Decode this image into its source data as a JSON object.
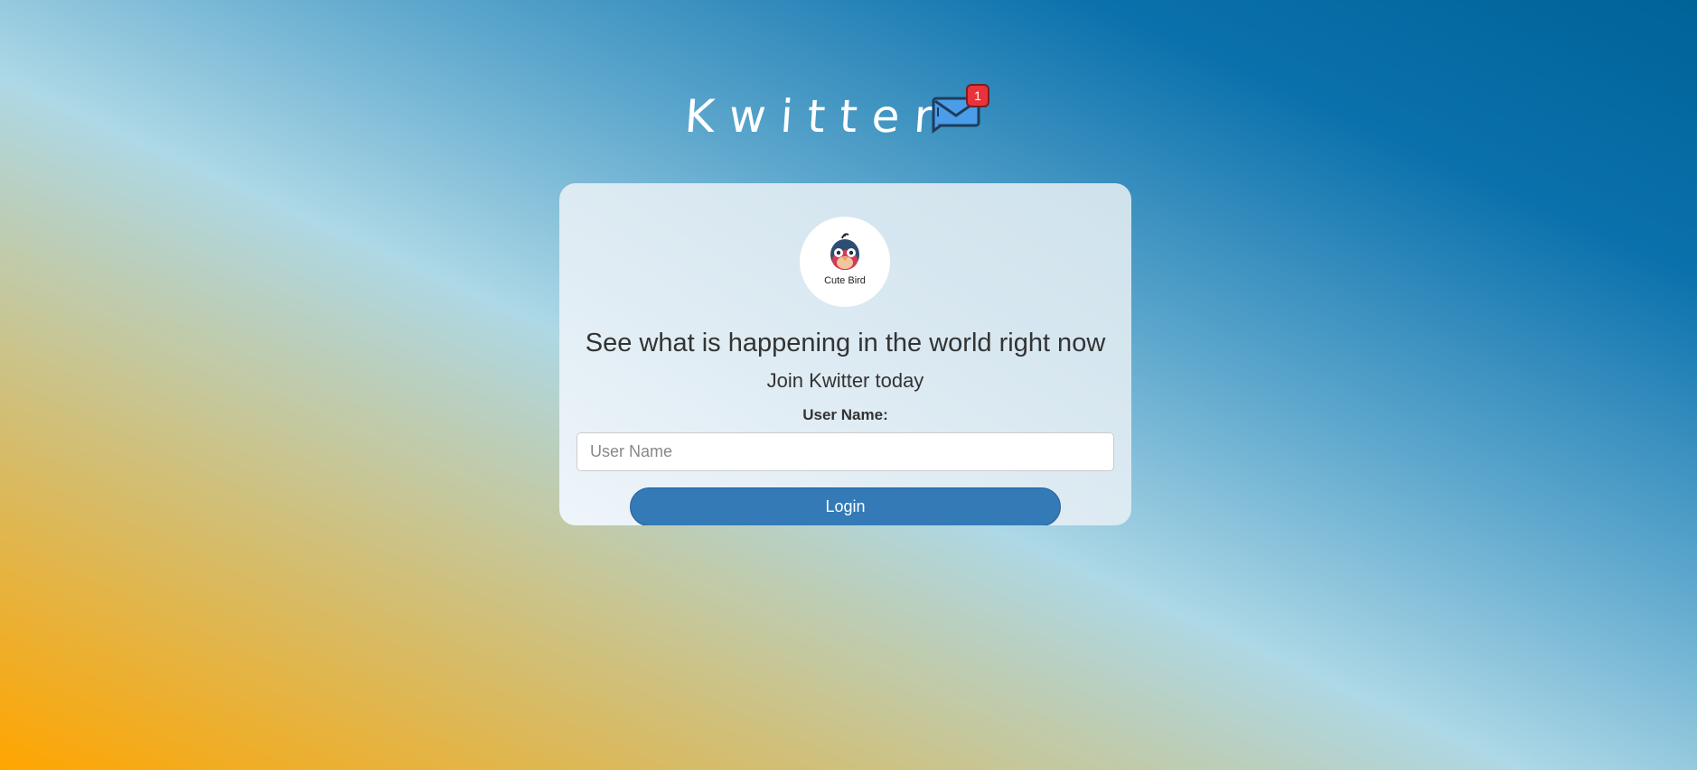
{
  "header": {
    "title": "Kwitter",
    "icon": "mail-icon",
    "notification_count": "1"
  },
  "card": {
    "logo": {
      "icon": "bird-icon",
      "caption": "Cute Bird"
    },
    "headline": "See what is happening in the world right now",
    "subheadline": "Join Kwitter today",
    "username_label": "User Name:",
    "username_placeholder": "User Name",
    "username_value": "",
    "login_label": "Login"
  },
  "colors": {
    "accent": "#337ab7",
    "badge": "#e8333a",
    "background_top": "#006398",
    "background_bottom": "#ffa500"
  }
}
